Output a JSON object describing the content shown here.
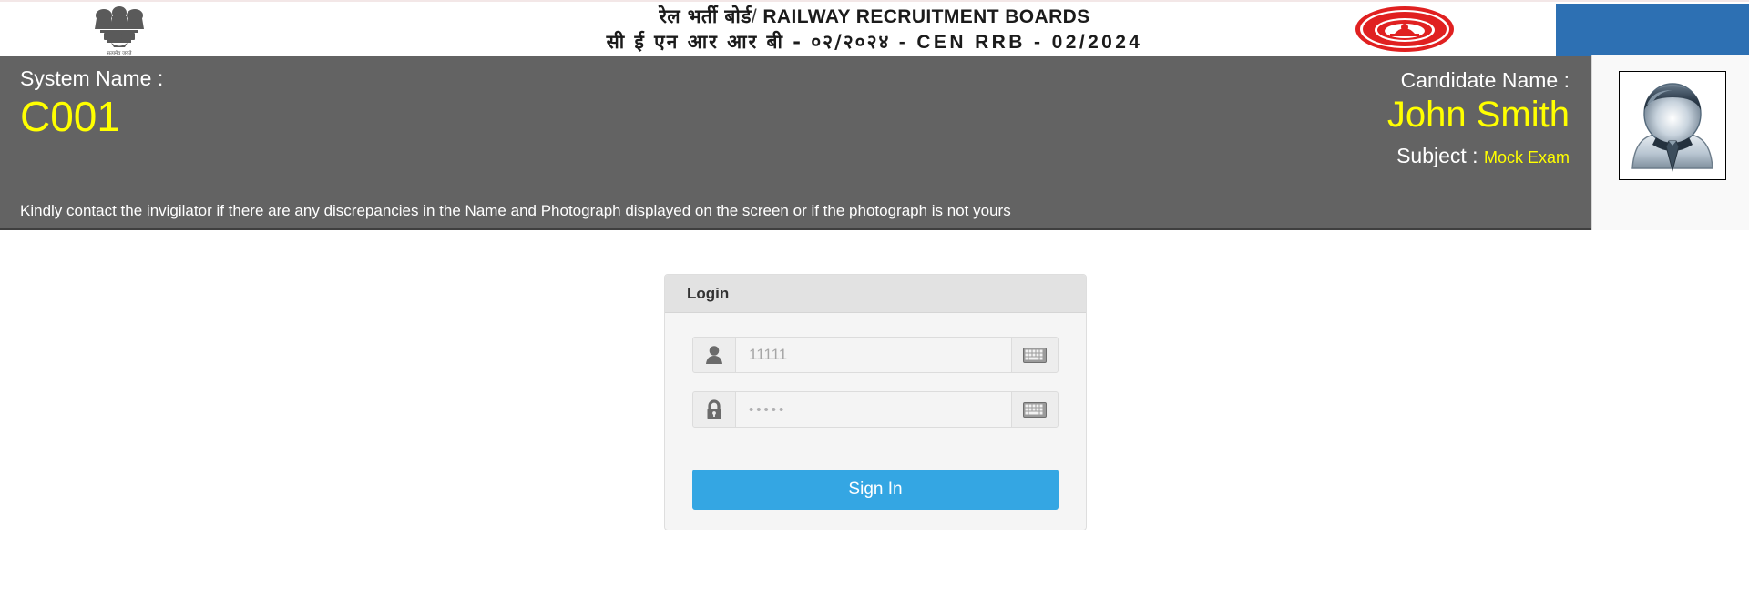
{
  "banner": {
    "org_title_hindi": "रेल भर्ती बोर्ड",
    "org_title_separator": "/",
    "org_title_english": "RAILWAY RECRUITMENT BOARDS",
    "exam_code_hindi": "सी ई एन आर आर बी - ०२/२०२४",
    "exam_code_separator": "-",
    "exam_code_english": "CEN RRB - 02/2024",
    "emblem_icon": "ashoka-lion-capital-emblem",
    "emblem_caption": "सत्यमेव जयते",
    "seal_icon": "indian-railways-seal",
    "seal_text": "INDIAN RAILWAYS",
    "accent_blue": "#2D70B3"
  },
  "candidate_bar": {
    "system_name_label": "System Name :",
    "system_name_value": "C001",
    "discrepancy_notice": "Kindly contact the invigilator if there are any discrepancies in the Name and Photograph displayed on the screen or if the photograph is not yours",
    "candidate_name_label": "Candidate Name :",
    "candidate_name_value": "John Smith",
    "subject_label": "Subject :",
    "subject_value": "Mock Exam",
    "photo_icon": "candidate-photo-placeholder",
    "background_color": "#636363",
    "highlight_color": "#FFFF00"
  },
  "login": {
    "panel_title": "Login",
    "username": {
      "icon": "user-icon",
      "value": "",
      "placeholder": "11111",
      "keyboard_button_icon": "keyboard-icon"
    },
    "password": {
      "icon": "lock-icon",
      "value": "",
      "placeholder": "•••••",
      "masked_display": "•••••",
      "keyboard_button_icon": "keyboard-icon"
    },
    "sign_in_label": "Sign In",
    "sign_in_color": "#34A6E3"
  }
}
